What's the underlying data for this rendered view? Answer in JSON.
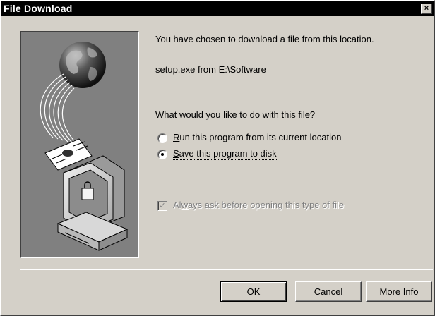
{
  "window": {
    "title": "File Download",
    "close_glyph": "×"
  },
  "illustration": {
    "icons": [
      "globe-icon",
      "document-icon",
      "computer-icon"
    ]
  },
  "message": {
    "intro": "You have chosen to download a file from this location.",
    "source": "setup.exe from E:\\Software",
    "question": "What would you like to do with this file?"
  },
  "options": {
    "run": {
      "accel": "R",
      "rest": "un this program from its current location",
      "selected": false
    },
    "save": {
      "accel": "S",
      "rest": "ave this program to disk",
      "selected": true
    }
  },
  "always_ask": {
    "pre": "Al",
    "accel": "w",
    "rest": "ays ask before opening this type of file",
    "checked": true,
    "enabled": false
  },
  "buttons": {
    "ok": "OK",
    "cancel": "Cancel",
    "more_info_accel": "M",
    "more_info_rest": "ore Info"
  }
}
